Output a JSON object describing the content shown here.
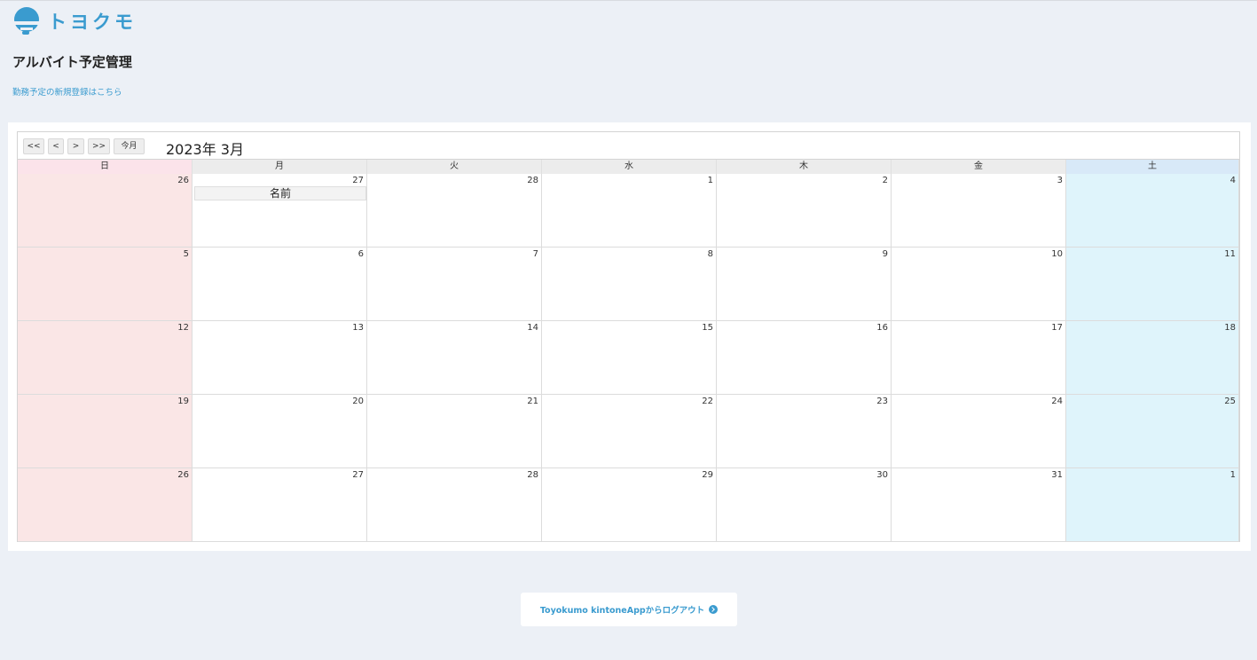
{
  "brand": {
    "name": "トヨクモ",
    "icon": "toyokumo-cloud-icon",
    "color": "#3a9bcf"
  },
  "page": {
    "title": "アルバイト予定管理",
    "new_link": "勤務予定の新規登録はこちら"
  },
  "calendar": {
    "nav": {
      "first": "<<",
      "prev": "<",
      "next": ">",
      "last": ">>",
      "today": "今月"
    },
    "month_title": "2023年 3月",
    "weekdays": [
      "日",
      "月",
      "火",
      "水",
      "木",
      "金",
      "土"
    ],
    "weeks": [
      [
        "26",
        "27",
        "28",
        "1",
        "2",
        "3",
        "4"
      ],
      [
        "5",
        "6",
        "7",
        "8",
        "9",
        "10",
        "11"
      ],
      [
        "12",
        "13",
        "14",
        "15",
        "16",
        "17",
        "18"
      ],
      [
        "19",
        "20",
        "21",
        "22",
        "23",
        "24",
        "25"
      ],
      [
        "26",
        "27",
        "28",
        "29",
        "30",
        "31",
        "1"
      ]
    ],
    "events": [
      {
        "week": 0,
        "day": 1,
        "label": "名前"
      }
    ],
    "colors": {
      "sunday": "#fae6e6",
      "saturday": "#dff4fb",
      "sunday_header": "#fbe3ea",
      "saturday_header": "#d8e9f8"
    }
  },
  "footer": {
    "logout_label": "Toyokumo kintoneAppからログアウト",
    "logout_icon": "chevron-right-circle-icon"
  }
}
